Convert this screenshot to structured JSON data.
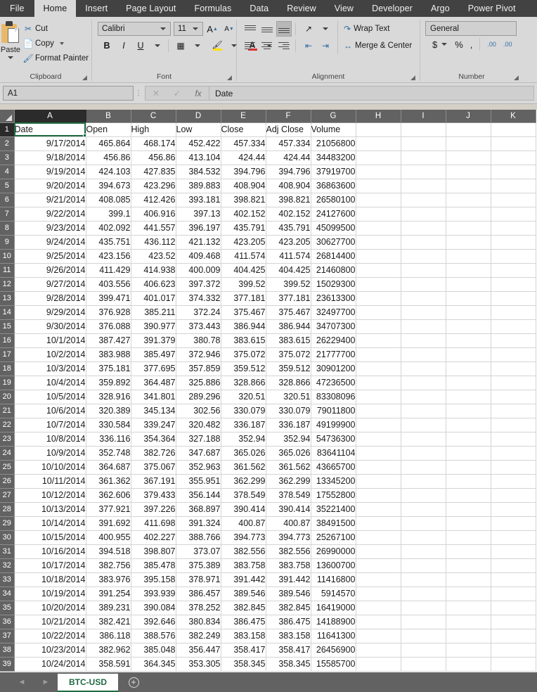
{
  "ribbon": {
    "tabs": [
      {
        "label": "File",
        "active": false
      },
      {
        "label": "Home",
        "active": true
      },
      {
        "label": "Insert",
        "active": false
      },
      {
        "label": "Page Layout",
        "active": false
      },
      {
        "label": "Formulas",
        "active": false
      },
      {
        "label": "Data",
        "active": false
      },
      {
        "label": "Review",
        "active": false
      },
      {
        "label": "View",
        "active": false
      },
      {
        "label": "Developer",
        "active": false
      },
      {
        "label": "Argo",
        "active": false
      },
      {
        "label": "Power Pivot",
        "active": false
      }
    ],
    "clipboard": {
      "group_label": "Clipboard",
      "paste_label": "Paste",
      "cut_label": "Cut",
      "copy_label": "Copy",
      "format_painter_label": "Format Painter"
    },
    "font": {
      "group_label": "Font",
      "font_name": "Calibri",
      "font_size": "11",
      "bold_label": "B",
      "italic_label": "I",
      "underline_label": "U",
      "grow_font_label": "A",
      "shrink_font_label": "A",
      "fill_color": "#ffe000",
      "font_color": "#e03131"
    },
    "alignment": {
      "group_label": "Alignment",
      "wrap_text_label": "Wrap Text",
      "merge_center_label": "Merge & Center"
    },
    "number": {
      "group_label": "Number",
      "format": "General",
      "currency_label": "$",
      "percent_label": "%",
      "comma_label": ",",
      "increase_decimal_label": ".00",
      "decrease_decimal_label": ".00"
    }
  },
  "formula_bar": {
    "name_box": "A1",
    "cancel_label": "✕",
    "enter_label": "✓",
    "function_label": "fx",
    "content": "Date"
  },
  "grid": {
    "columns": [
      "A",
      "B",
      "C",
      "D",
      "E",
      "F",
      "G",
      "H",
      "I",
      "J",
      "K"
    ],
    "selected_column": "A",
    "selected_row": 1,
    "active_cell": "A1",
    "headers": [
      "Date",
      "Open",
      "High",
      "Low",
      "Close",
      "Adj Close",
      "Volume"
    ],
    "rows": [
      [
        "9/17/2014",
        "465.864",
        "468.174",
        "452.422",
        "457.334",
        "457.334",
        "21056800"
      ],
      [
        "9/18/2014",
        "456.86",
        "456.86",
        "413.104",
        "424.44",
        "424.44",
        "34483200"
      ],
      [
        "9/19/2014",
        "424.103",
        "427.835",
        "384.532",
        "394.796",
        "394.796",
        "37919700"
      ],
      [
        "9/20/2014",
        "394.673",
        "423.296",
        "389.883",
        "408.904",
        "408.904",
        "36863600"
      ],
      [
        "9/21/2014",
        "408.085",
        "412.426",
        "393.181",
        "398.821",
        "398.821",
        "26580100"
      ],
      [
        "9/22/2014",
        "399.1",
        "406.916",
        "397.13",
        "402.152",
        "402.152",
        "24127600"
      ],
      [
        "9/23/2014",
        "402.092",
        "441.557",
        "396.197",
        "435.791",
        "435.791",
        "45099500"
      ],
      [
        "9/24/2014",
        "435.751",
        "436.112",
        "421.132",
        "423.205",
        "423.205",
        "30627700"
      ],
      [
        "9/25/2014",
        "423.156",
        "423.52",
        "409.468",
        "411.574",
        "411.574",
        "26814400"
      ],
      [
        "9/26/2014",
        "411.429",
        "414.938",
        "400.009",
        "404.425",
        "404.425",
        "21460800"
      ],
      [
        "9/27/2014",
        "403.556",
        "406.623",
        "397.372",
        "399.52",
        "399.52",
        "15029300"
      ],
      [
        "9/28/2014",
        "399.471",
        "401.017",
        "374.332",
        "377.181",
        "377.181",
        "23613300"
      ],
      [
        "9/29/2014",
        "376.928",
        "385.211",
        "372.24",
        "375.467",
        "375.467",
        "32497700"
      ],
      [
        "9/30/2014",
        "376.088",
        "390.977",
        "373.443",
        "386.944",
        "386.944",
        "34707300"
      ],
      [
        "10/1/2014",
        "387.427",
        "391.379",
        "380.78",
        "383.615",
        "383.615",
        "26229400"
      ],
      [
        "10/2/2014",
        "383.988",
        "385.497",
        "372.946",
        "375.072",
        "375.072",
        "21777700"
      ],
      [
        "10/3/2014",
        "375.181",
        "377.695",
        "357.859",
        "359.512",
        "359.512",
        "30901200"
      ],
      [
        "10/4/2014",
        "359.892",
        "364.487",
        "325.886",
        "328.866",
        "328.866",
        "47236500"
      ],
      [
        "10/5/2014",
        "328.916",
        "341.801",
        "289.296",
        "320.51",
        "320.51",
        "83308096"
      ],
      [
        "10/6/2014",
        "320.389",
        "345.134",
        "302.56",
        "330.079",
        "330.079",
        "79011800"
      ],
      [
        "10/7/2014",
        "330.584",
        "339.247",
        "320.482",
        "336.187",
        "336.187",
        "49199900"
      ],
      [
        "10/8/2014",
        "336.116",
        "354.364",
        "327.188",
        "352.94",
        "352.94",
        "54736300"
      ],
      [
        "10/9/2014",
        "352.748",
        "382.726",
        "347.687",
        "365.026",
        "365.026",
        "83641104"
      ],
      [
        "10/10/2014",
        "364.687",
        "375.067",
        "352.963",
        "361.562",
        "361.562",
        "43665700"
      ],
      [
        "10/11/2014",
        "361.362",
        "367.191",
        "355.951",
        "362.299",
        "362.299",
        "13345200"
      ],
      [
        "10/12/2014",
        "362.606",
        "379.433",
        "356.144",
        "378.549",
        "378.549",
        "17552800"
      ],
      [
        "10/13/2014",
        "377.921",
        "397.226",
        "368.897",
        "390.414",
        "390.414",
        "35221400"
      ],
      [
        "10/14/2014",
        "391.692",
        "411.698",
        "391.324",
        "400.87",
        "400.87",
        "38491500"
      ],
      [
        "10/15/2014",
        "400.955",
        "402.227",
        "388.766",
        "394.773",
        "394.773",
        "25267100"
      ],
      [
        "10/16/2014",
        "394.518",
        "398.807",
        "373.07",
        "382.556",
        "382.556",
        "26990000"
      ],
      [
        "10/17/2014",
        "382.756",
        "385.478",
        "375.389",
        "383.758",
        "383.758",
        "13600700"
      ],
      [
        "10/18/2014",
        "383.976",
        "395.158",
        "378.971",
        "391.442",
        "391.442",
        "11416800"
      ],
      [
        "10/19/2014",
        "391.254",
        "393.939",
        "386.457",
        "389.546",
        "389.546",
        "5914570"
      ],
      [
        "10/20/2014",
        "389.231",
        "390.084",
        "378.252",
        "382.845",
        "382.845",
        "16419000"
      ],
      [
        "10/21/2014",
        "382.421",
        "392.646",
        "380.834",
        "386.475",
        "386.475",
        "14188900"
      ],
      [
        "10/22/2014",
        "386.118",
        "388.576",
        "382.249",
        "383.158",
        "383.158",
        "11641300"
      ],
      [
        "10/23/2014",
        "382.962",
        "385.048",
        "356.447",
        "358.417",
        "358.417",
        "26456900"
      ],
      [
        "10/24/2014",
        "358.591",
        "364.345",
        "353.305",
        "358.345",
        "358.345",
        "15585700"
      ]
    ]
  },
  "sheet_tabs": {
    "prev_label": "◄",
    "next_label": "►",
    "tabs": [
      {
        "label": "BTC-USD",
        "active": true
      }
    ],
    "add_label": "+"
  }
}
